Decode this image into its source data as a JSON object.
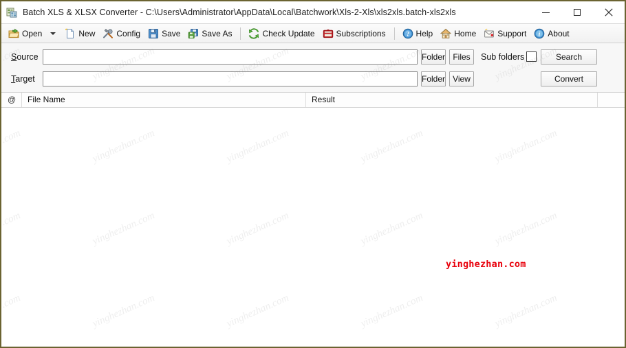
{
  "window": {
    "title": "Batch XLS & XLSX Converter - C:\\Users\\Administrator\\AppData\\Local\\Batchwork\\Xls-2-Xls\\xls2xls.batch-xls2xls",
    "app_icon": "app-xls-converter-icon",
    "border_color": "#6b6331",
    "controls": {
      "minimize": "minimize-icon",
      "maximize": "maximize-icon",
      "close": "close-icon"
    }
  },
  "toolbar": {
    "items": [
      {
        "label": "Open",
        "icon": "open-folder-icon",
        "dropdown": true
      },
      {
        "label": "New",
        "icon": "new-document-icon",
        "dropdown": false
      },
      {
        "label": "Config",
        "icon": "tools-config-icon",
        "dropdown": false
      },
      {
        "label": "Save",
        "icon": "save-floppy-icon",
        "dropdown": false
      },
      {
        "label": "Save As",
        "icon": "save-as-floppy-icon",
        "dropdown": false
      },
      {
        "label": "Check Update",
        "icon": "refresh-arrows-icon",
        "dropdown": false
      },
      {
        "label": "Subscriptions",
        "icon": "subscriptions-icon",
        "dropdown": false
      },
      {
        "label": "Help",
        "icon": "help-question-icon",
        "dropdown": false
      },
      {
        "label": "Home",
        "icon": "home-house-icon",
        "dropdown": false
      },
      {
        "label": "Support",
        "icon": "support-mail-icon",
        "dropdown": false
      },
      {
        "label": "About",
        "icon": "about-info-icon",
        "dropdown": false
      }
    ]
  },
  "form": {
    "source": {
      "label": "Source",
      "mnemonic": "S",
      "value": "",
      "folder_button": "Folder",
      "files_button": "Files",
      "subfolders_label": "Sub folders",
      "subfolders_checked": false,
      "action_button": "Search"
    },
    "target": {
      "label": "Target",
      "mnemonic": "T",
      "value": "",
      "folder_button": "Folder",
      "view_button": "View",
      "action_button": "Convert"
    }
  },
  "list": {
    "columns": [
      {
        "key": "at",
        "label": "@"
      },
      {
        "key": "name",
        "label": "File Name"
      },
      {
        "key": "result",
        "label": "Result"
      }
    ],
    "rows": []
  },
  "watermarks": {
    "tiled_text": "yinghezhan.com",
    "red_text": "yinghezhan.com",
    "red_color": "#e8000b"
  }
}
